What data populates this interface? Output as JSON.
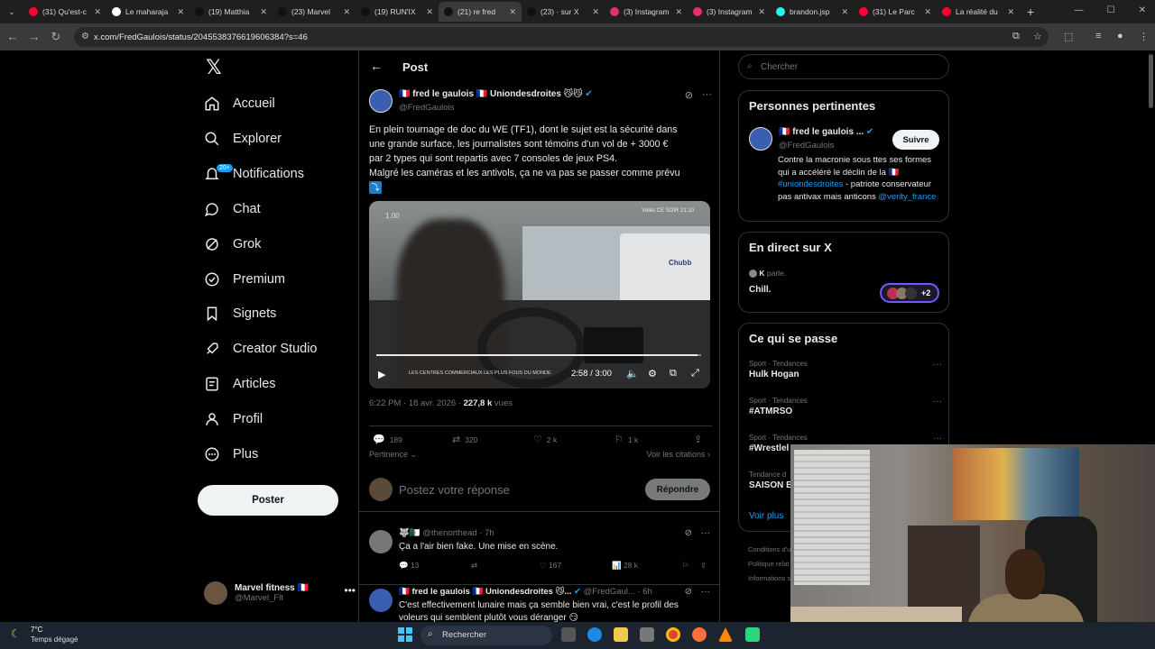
{
  "browser": {
    "tabs": [
      {
        "title": "(31) Qu'est-c",
        "fav": "#ff0033",
        "active": false
      },
      {
        "title": "Le maharaja",
        "fav": "#ffffff",
        "active": false
      },
      {
        "title": "(19) Matthia",
        "fav": "#111111",
        "active": false
      },
      {
        "title": "(23) Marvel",
        "fav": "#111111",
        "active": false
      },
      {
        "title": "(19) RUN'IX",
        "fav": "#111111",
        "active": false
      },
      {
        "title": "(21) re fred",
        "fav": "#111111",
        "active": true
      },
      {
        "title": "(23) · sur X",
        "fav": "#111111",
        "active": false
      },
      {
        "title": "(3) Instagram",
        "fav": "#e1306c",
        "active": false
      },
      {
        "title": "(3) Instagram",
        "fav": "#e1306c",
        "active": false
      },
      {
        "title": "brandon.jsp",
        "fav": "#25f4ee",
        "active": false
      },
      {
        "title": "(31) Le Parc",
        "fav": "#ff0033",
        "active": false
      },
      {
        "title": "La réalité du",
        "fav": "#ff0033",
        "active": false
      }
    ],
    "url": "x.com/FredGaulois/status/2045538376619606384?s=46"
  },
  "nav": {
    "items": [
      {
        "label": "Accueil",
        "icon": "home-icon"
      },
      {
        "label": "Explorer",
        "icon": "search-icon"
      },
      {
        "label": "Notifications",
        "icon": "bell-icon"
      },
      {
        "label": "Chat",
        "icon": "chat-icon"
      },
      {
        "label": "Grok",
        "icon": "grok-icon"
      },
      {
        "label": "Premium",
        "icon": "premium-icon"
      },
      {
        "label": "Signets",
        "icon": "bookmark-icon"
      },
      {
        "label": "Creator Studio",
        "icon": "rocket-icon"
      },
      {
        "label": "Articles",
        "icon": "article-icon"
      },
      {
        "label": "Profil",
        "icon": "profile-icon"
      },
      {
        "label": "Plus",
        "icon": "more-icon"
      }
    ],
    "notif_badge": "20+",
    "post_button": "Poster",
    "account": {
      "name": "Marvel fitness 🇫🇷",
      "handle": "@Marvel_Flt"
    }
  },
  "post": {
    "header_title": "Post",
    "author_name": "🇫🇷 fred le gaulois 🇫🇷 Uniondesdroites 😼😼",
    "author_handle": "@FredGaulois",
    "text_lines": [
      "En plein tournage de doc du WE (TF1), dont le sujet est la sécurité dans",
      "une grande surface, les journalistes sont témoins d'un vol de + 3000 €",
      "par 2 types qui sont repartis avec 7 consoles de jeux PS4.",
      "Malgré les caméras et les antivols, ça ne va pas se passer comme prévu"
    ],
    "emoji": "⤵️",
    "video": {
      "overlay_time": "1.00",
      "overlay_logo": "Volés CE SOIR 21:10",
      "caption": "LES CENTRES COMMERCIAUX LES PLUS FOUS DU MONDE",
      "brand": "Chubb",
      "time": "2:58 / 3:00",
      "progress": 0.99
    },
    "meta_time": "6:22 PM · 18 avr. 2026 · ",
    "views_count": "227,8 k",
    "views_label": " vues",
    "stats": {
      "replies": "189",
      "reposts": "320",
      "likes": "2 k",
      "bookmarks": "1 k"
    },
    "sort_label": "Pertinence ⌄",
    "quotes_label": "Voir les citations ›",
    "reply_placeholder": "Postez votre réponse",
    "reply_button": "Répondre"
  },
  "replies": [
    {
      "name": "🐺🇩🇿",
      "handle": "@thenorthead · 7h",
      "text": [
        "Ça a l'air bien fake. Une mise en scène."
      ],
      "stats": {
        "replies": "13",
        "reposts": "",
        "likes": "167",
        "views": "28 k"
      }
    },
    {
      "name": "🇫🇷 fred le gaulois 🇫🇷 Uniondesdroites 😼...",
      "handle": "@FredGaul... · 6h",
      "text": [
        "C'est effectivement lunaire mais ça semble bien vrai, c'est le profil des",
        "voleurs qui semblent plutôt vous déranger 😏"
      ],
      "stats": {
        "replies": "",
        "reposts": "",
        "likes": "",
        "views": ""
      }
    }
  ],
  "sidebar": {
    "search_placeholder": "Chercher",
    "relevant": {
      "title": "Personnes pertinentes",
      "name": "🇫🇷 fred le gaulois ...",
      "handle": "@FredGaulois",
      "follow": "Suivre",
      "bio_1": "Contre la macronie sous ttes ses formes qui a accéléré le déclin de la 🇫🇷 ",
      "bio_tag": "#uniondesdroites",
      "bio_2": " - patriote conservateur pas antivax mais anticons ",
      "bio_mention": "@verity_france"
    },
    "live": {
      "title": "En direct sur X",
      "speaker": "K",
      "speaker_suffix": " parle.",
      "space_title": "Chill.",
      "more": "+2"
    },
    "trends": {
      "title": "Ce qui se passe",
      "items": [
        {
          "category": "Sport · Tendances",
          "topic": "Hulk Hogan"
        },
        {
          "category": "Sport · Tendances",
          "topic": "#ATMRSO"
        },
        {
          "category": "Sport · Tendances",
          "topic": "#Wrestlel"
        },
        {
          "category": "Tendance d",
          "topic": "SAISON B"
        }
      ],
      "more": "Voir plus"
    },
    "footer": [
      "Conditions d'u",
      "Politique relat",
      "Informations s"
    ]
  },
  "taskbar": {
    "temp": "7°C",
    "weather": "Temps dégagé",
    "search": "Rechercher"
  }
}
